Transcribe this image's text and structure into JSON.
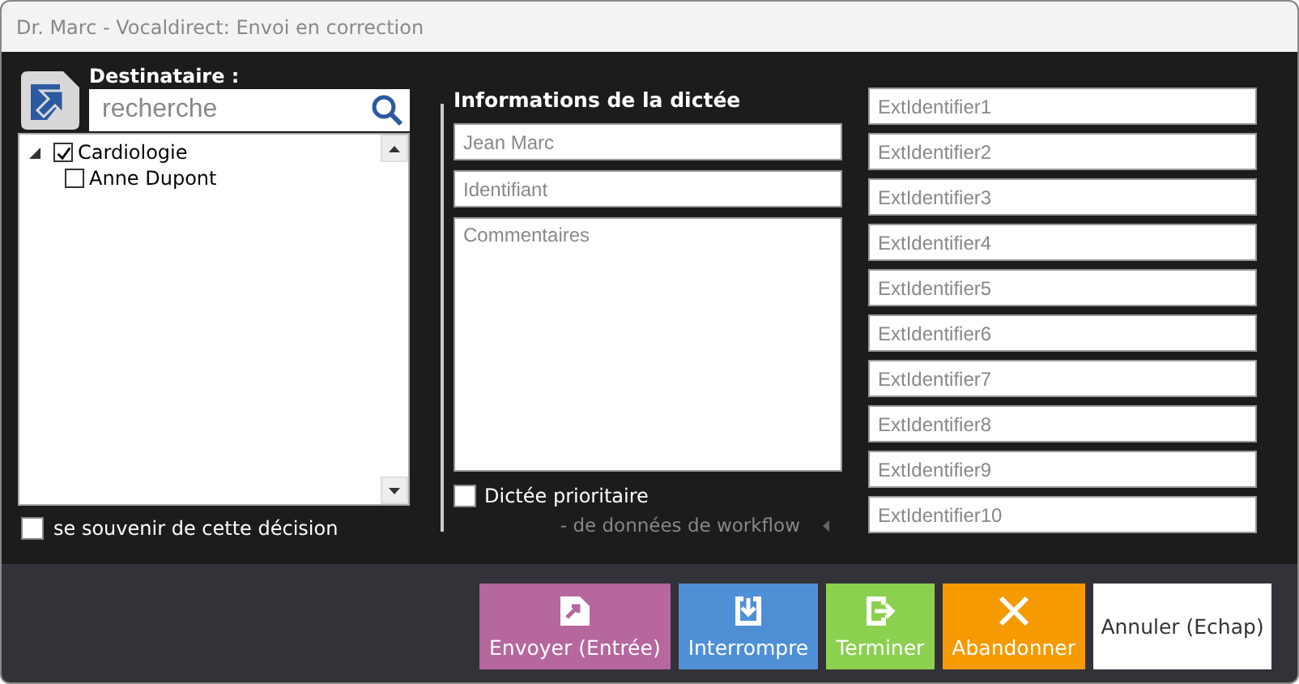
{
  "window": {
    "title": "Dr. Marc - Vocaldirect: Envoi en correction"
  },
  "recipient": {
    "label": "Destinataire :",
    "search": {
      "placeholder": "recherche"
    },
    "tree": [
      {
        "label": "Cardiologie",
        "checked": true,
        "expanded": true,
        "children": [
          {
            "label": "Anne Dupont",
            "checked": false
          }
        ]
      }
    ],
    "remember": {
      "label": "se souvenir de cette décision",
      "checked": false
    }
  },
  "dictation": {
    "title": "Informations de la dictée",
    "author": {
      "placeholder": "Jean Marc"
    },
    "identifier": {
      "placeholder": "Identifiant"
    },
    "comments": {
      "placeholder": "Commentaires"
    },
    "priority": {
      "label": "Dictée prioritaire",
      "checked": false
    },
    "workflow_toggle": "- de données de workflow"
  },
  "ext_fields": [
    {
      "placeholder": "ExtIdentifier1"
    },
    {
      "placeholder": "ExtIdentifier2"
    },
    {
      "placeholder": "ExtIdentifier3"
    },
    {
      "placeholder": "ExtIdentifier4"
    },
    {
      "placeholder": "ExtIdentifier5"
    },
    {
      "placeholder": "ExtIdentifier6"
    },
    {
      "placeholder": "ExtIdentifier7"
    },
    {
      "placeholder": "ExtIdentifier8"
    },
    {
      "placeholder": "ExtIdentifier9"
    },
    {
      "placeholder": "ExtIdentifier10"
    }
  ],
  "buttons": [
    {
      "label": "Envoyer (Entrée)",
      "kind": "send",
      "color": "#b5679e"
    },
    {
      "label": "Interrompre",
      "kind": "interrupt",
      "color": "#4f8fd6"
    },
    {
      "label": "Terminer",
      "kind": "finish",
      "color": "#8bd14f"
    },
    {
      "label": "Abandonner",
      "kind": "abandon",
      "color": "#f59a00"
    },
    {
      "label": "Annuler (Echap)",
      "kind": "cancel",
      "color": "#ffffff"
    }
  ]
}
